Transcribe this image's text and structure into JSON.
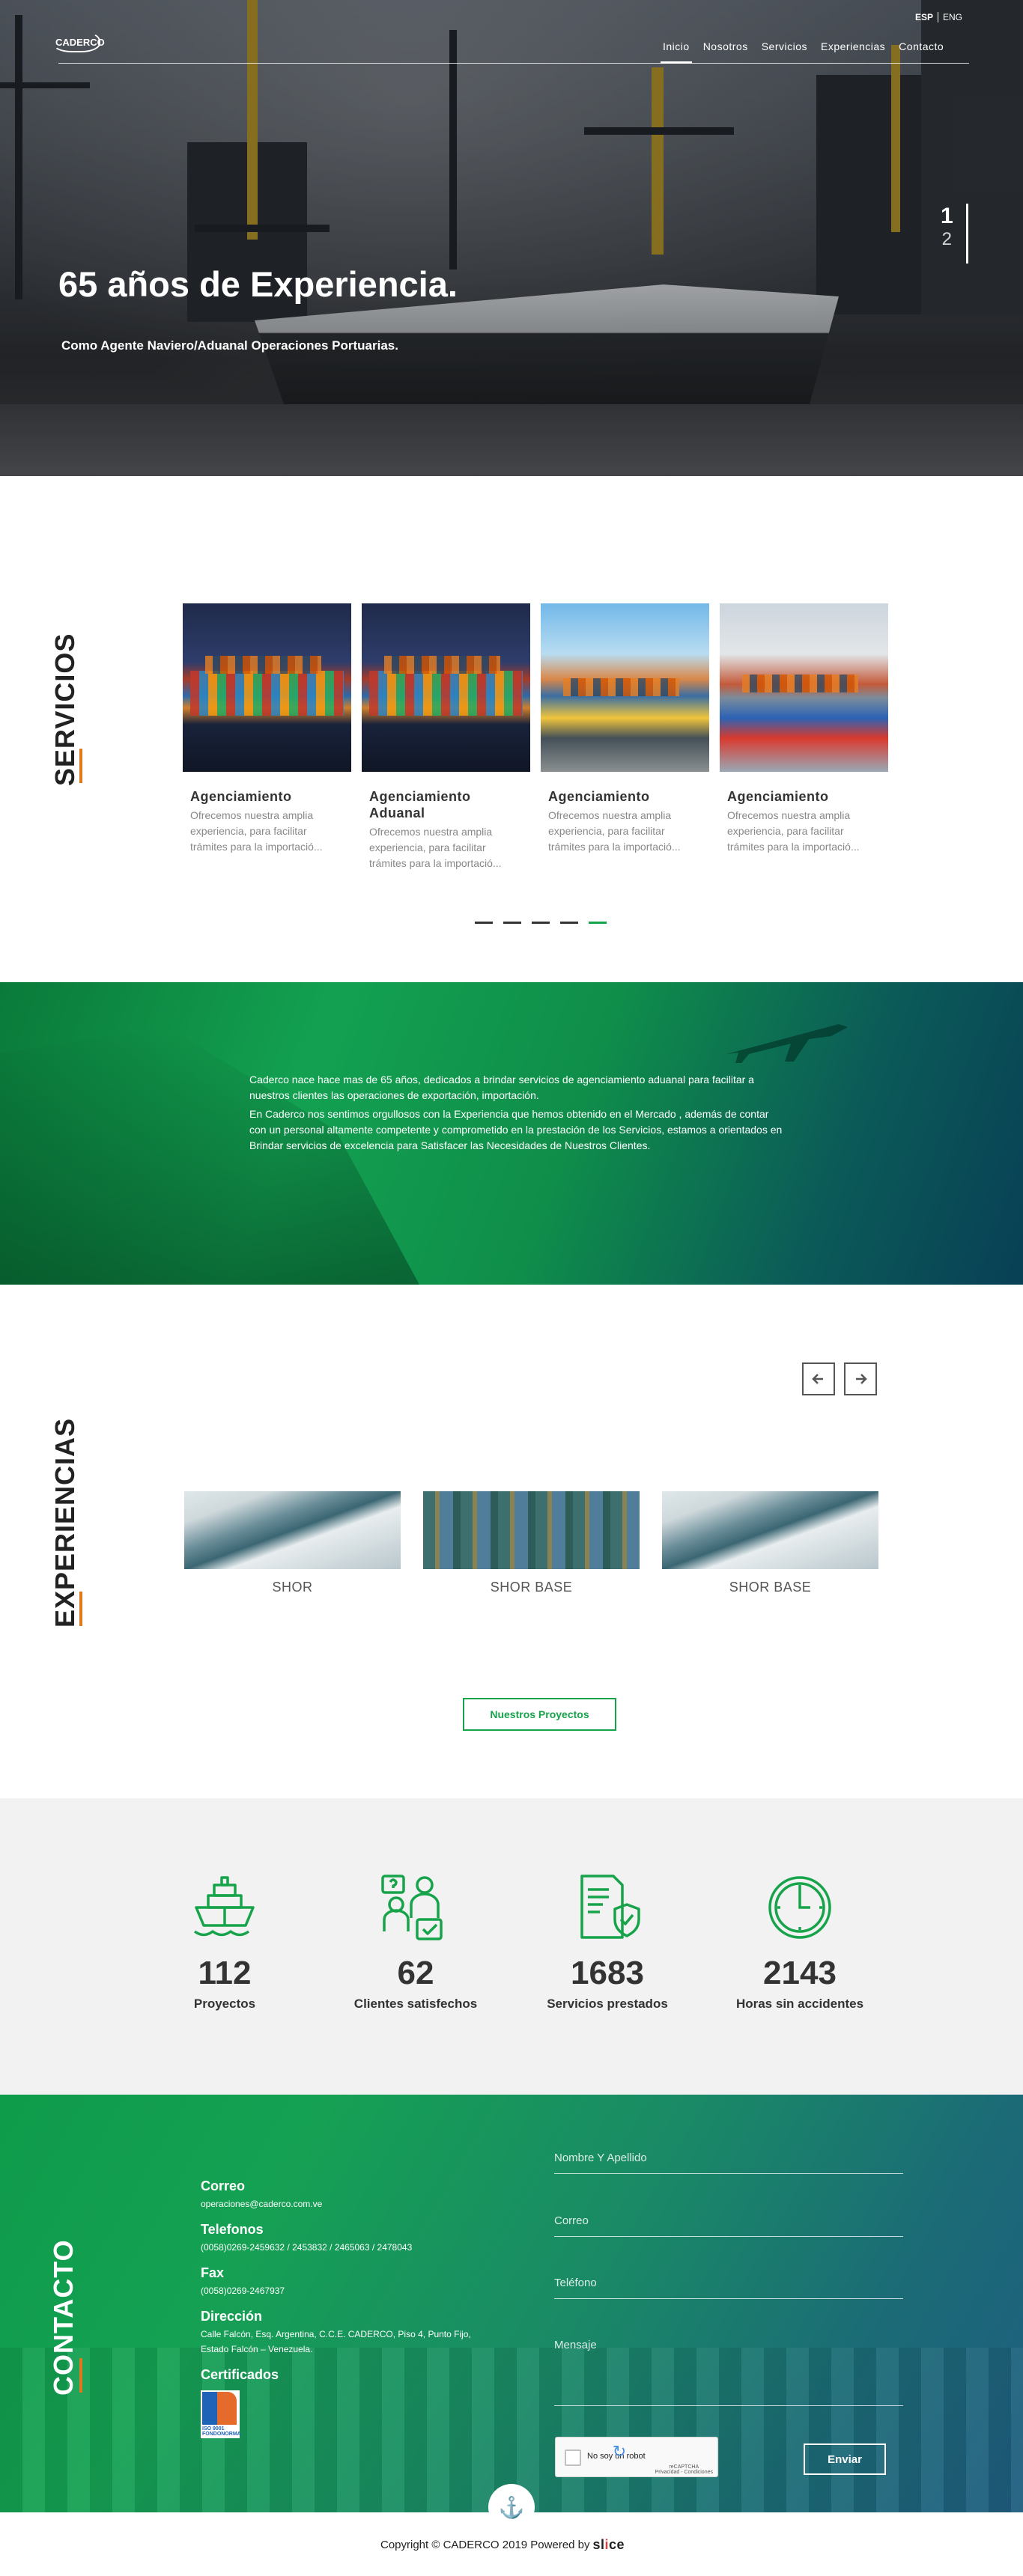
{
  "header": {
    "logo_text": "CADERCO",
    "languages": [
      "ESP",
      "ENG"
    ],
    "nav": [
      "Inicio",
      "Nosotros",
      "Servicios",
      "Experiencias",
      "Contacto"
    ]
  },
  "hero": {
    "title": "65 años de Experiencia.",
    "subtitle": "Como Agente Naviero/Aduanal Operaciones Portuarias.",
    "slides": [
      "1",
      "2"
    ]
  },
  "servicios": {
    "title": "SERVICIOS",
    "cards": [
      {
        "title": "Agenciamiento",
        "desc": "Ofrecemos nuestra amplia experiencia, para facilitar trámites para la importació..."
      },
      {
        "title": "Agenciamiento Aduanal",
        "desc": "Ofrecemos nuestra amplia experiencia, para facilitar trámites para la importació..."
      },
      {
        "title": "Agenciamiento",
        "desc": "Ofrecemos nuestra amplia experiencia, para facilitar trámites para la importació..."
      },
      {
        "title": "Agenciamiento",
        "desc": "Ofrecemos nuestra amplia experiencia, para facilitar trámites para la importació..."
      }
    ]
  },
  "about": {
    "p1": "Caderco nace hace mas de 65 años, dedicados a brindar servicios de agenciamiento aduanal para facilitar a nuestros clientes las operaciones de exportación, importación.",
    "p2": "En Caderco nos sentimos orgullosos con la Experiencia que hemos obtenido en el Mercado , además de contar con un personal altamente competente y comprometido en la prestación de los Servicios, estamos a orientados en Brindar servicios de excelencia para Satisfacer las Necesidades de Nuestros Clientes."
  },
  "experiencias": {
    "title": "EXPERIENCIAS",
    "items": [
      "SHOR",
      "SHOR BASE",
      "SHOR BASE"
    ],
    "button": "Nuestros Proyectos"
  },
  "stats": [
    {
      "value": "112",
      "label": "Proyectos",
      "icon": "ship-icon"
    },
    {
      "value": "62",
      "label": "Clientes satisfechos",
      "icon": "clients-icon"
    },
    {
      "value": "1683",
      "label": "Servicios prestados",
      "icon": "certificate-icon"
    },
    {
      "value": "2143",
      "label": "Horas sin accidentes",
      "icon": "clock-icon"
    }
  ],
  "contacto": {
    "title": "CONTACTO",
    "correo_label": "Correo",
    "correo": "operaciones@caderco.com.ve",
    "telefonos_label": "Telefonos",
    "telefonos": "(0058)0269-2459632 / 2453832 / 2465063 / 2478043",
    "fax_label": "Fax",
    "fax": "(0058)0269-2467937",
    "direccion_label": "Dirección",
    "direccion": "Calle Falcón, Esq. Argentina, C.C.E. CADERCO, Piso 4, Punto Fijo, Estado Falcón – Venezuela.",
    "certificados_label": "Certificados",
    "cert_text": "ISO 9001 FONDONORMA",
    "form": {
      "nombre": "Nombre Y Apellido",
      "correo": "Correo",
      "telefono": "Teléfono",
      "mensaje": "Mensaje",
      "captcha": "No soy un robot",
      "captcha_brand": "reCAPTCHA",
      "captcha_terms": "Privacidad - Condiciones",
      "submit": "Enviar"
    }
  },
  "footer": {
    "copyright": "Copyright © CADERCO 2019 Powered by",
    "brand_pre": "sl",
    "brand_i": "i",
    "brand_post": "ce"
  },
  "colors": {
    "accent": "#16a34a",
    "orange": "#e0781f"
  }
}
